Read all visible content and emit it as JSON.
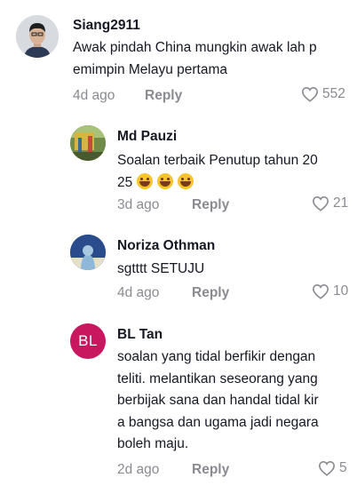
{
  "comments": [
    {
      "username": "Siang2911",
      "text_lines": [
        "Awak pindah China mungkin awak lah p",
        "emimpin Melayu pertama"
      ],
      "time": "4d ago",
      "reply": "Reply",
      "likes": "552",
      "avatar": "photo"
    },
    {
      "username": "Md Pauzi",
      "text_lines": [
        "Soalan terbaik Penutup tahun 20",
        "25"
      ],
      "emojis": [
        "grinning-sweat-emoji",
        "grinning-sweat-emoji",
        "grinning-sweat-emoji"
      ],
      "time": "3d ago",
      "reply": "Reply",
      "likes": "21",
      "avatar": "photo"
    },
    {
      "username": "Noriza Othman",
      "text_lines": [
        "sgtttt SETUJU"
      ],
      "time": "4d ago",
      "reply": "Reply",
      "likes": "10",
      "avatar": "photo"
    },
    {
      "username": "BL Tan",
      "avatar_initials": "BL",
      "avatar_color": "#c8175f",
      "text_lines": [
        "soalan yang tidal berfikir dengan",
        "teliti. melantikan seseorang yang",
        "berbijak sana dan handal tidal kir",
        "a bangsa dan ugama jadi negara",
        "boleh maju."
      ],
      "time": "2d ago",
      "reply": "Reply",
      "likes": "5"
    }
  ]
}
